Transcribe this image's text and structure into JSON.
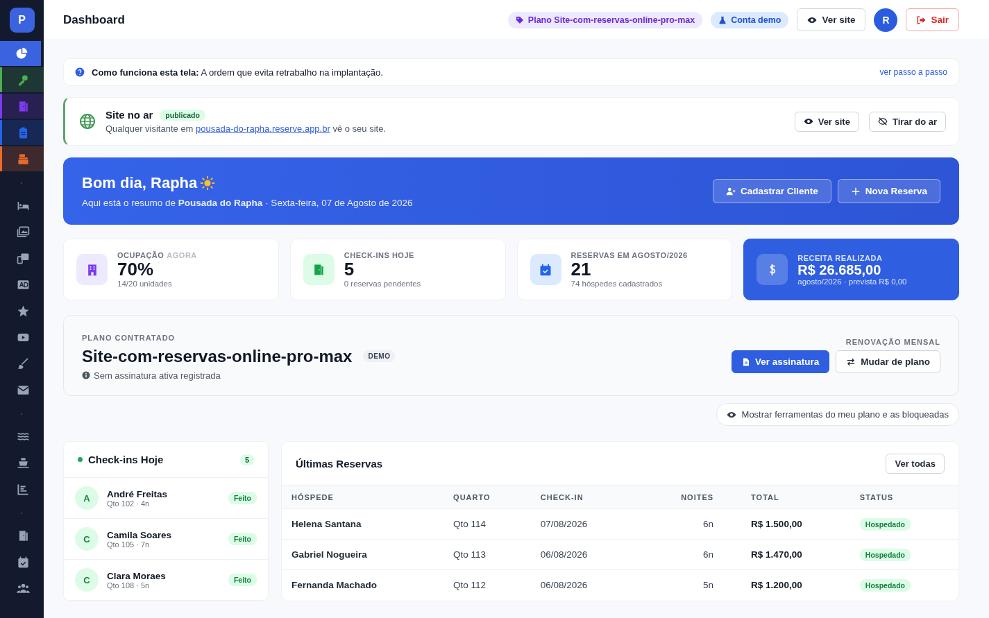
{
  "sidebar": {
    "logo": "P",
    "items": [
      {
        "selected": true
      },
      {
        "selected": false,
        "color": "#4caf50"
      },
      {
        "selected": false,
        "color": "#7c3aed"
      },
      {
        "selected": false,
        "color": "#2563eb"
      },
      {
        "selected": false,
        "color": "#ea6a2a"
      },
      {
        "selected": false
      },
      {
        "selected": false
      },
      {
        "selected": false
      },
      {
        "selected": false
      },
      {
        "selected": false
      },
      {
        "selected": false
      },
      {
        "selected": false
      },
      {
        "selected": false
      },
      {
        "selected": false
      },
      {
        "selected": false
      },
      {
        "selected": false
      },
      {
        "selected": false
      },
      {
        "selected": false
      },
      {
        "selected": false
      }
    ]
  },
  "header": {
    "title": "Dashboard",
    "badges": [
      {
        "text": "Plano Site-com-reservas-online-pro-max",
        "kind": "plan"
      },
      {
        "text": "Conta demo",
        "kind": "demo"
      }
    ],
    "view_button": "Ver site",
    "avatar": "R",
    "logout": "Sair"
  },
  "info_bar": {
    "text": "**Como funciona esta tela:** A ordem que evita retrabalho na implantação.",
    "link": "ver passo a passo"
  },
  "site_status": {
    "title": "Site no ar",
    "badge": "publicado",
    "text_before": "Qualquer visitante em",
    "link": "pousada-do-rapha.reserve.app.br",
    "text_after": "vê o seu site.",
    "buttons": [
      "Ver site",
      "Tirar do ar"
    ]
  },
  "welcome": {
    "greeting": "Bom dia, Rapha",
    "subtitle": "Aqui está o resumo de **Pousada do Rapha** · Sexta-feira, 07 de Agosto de 2026",
    "buttons": [
      "Cadastrar Cliente",
      "Nova Reserva"
    ]
  },
  "stats": [
    {
      "kind": "occupancy",
      "label": "OCUPAÇÃO",
      "label_muted": "AGORA",
      "value": "70%",
      "note": "14/20 unidades",
      "highlighted": false
    },
    {
      "kind": "checkins",
      "label": "CHECK-INS HOJE",
      "value": "5",
      "note": "0 reservas pendentes",
      "highlighted": false
    },
    {
      "kind": "reservations",
      "label": "RESERVAS EM AGOSTO/2026",
      "value": "21",
      "note": "74 hóspedes cadastrados",
      "highlighted": false
    },
    {
      "kind": "revenue",
      "label": "RECEITA REALIZADA",
      "value": "R$ 26.685,00",
      "note": "agosto/2026 · prevista R$ 0,00",
      "highlighted": true
    }
  ],
  "plan": {
    "label": "PLANO CONTRATADO",
    "name": "Site-com-reservas-online-pro-max",
    "badge": "DEMO",
    "note": "Sem assinatura ativa registrada",
    "renewal": "RENOVAÇÃO MENSAL",
    "buttons": [
      "Ver assinatura",
      "Mudar de plano"
    ]
  },
  "tools_toggle": "Mostrar ferramentas do meu plano e as bloqueadas",
  "checkins": {
    "title": "Check-ins Hoje",
    "count": "5",
    "items": [
      {
        "initial": "A",
        "name": "André Freitas",
        "detail": "Qto 102 · 4n",
        "status": "Feito"
      },
      {
        "initial": "C",
        "name": "Camila Soares",
        "detail": "Qto 105 · 7n",
        "status": "Feito"
      },
      {
        "initial": "C",
        "name": "Clara Moraes",
        "detail": "Qto 108 · 5n",
        "status": "Feito"
      }
    ]
  },
  "reservations": {
    "title": "Últimas Reservas",
    "button": "Ver todas",
    "columns": [
      "HÓSPEDE",
      "QUARTO",
      "CHECK-IN",
      "NOITES",
      "TOTAL",
      "STATUS"
    ],
    "rows": [
      {
        "guest": "Helena Santana",
        "room": "Qto 114",
        "checkin": "07/08/2026",
        "nights": "6n",
        "total": "R$ 1.500,00",
        "status": "Hospedado"
      },
      {
        "guest": "Gabriel Nogueira",
        "room": "Qto 113",
        "checkin": "06/08/2026",
        "nights": "6n",
        "total": "R$ 1.470,00",
        "status": "Hospedado"
      },
      {
        "guest": "Fernanda Machado",
        "room": "Qto 112",
        "checkin": "06/08/2026",
        "nights": "5n",
        "total": "R$ 1.200,00",
        "status": "Hospedado"
      }
    ]
  }
}
